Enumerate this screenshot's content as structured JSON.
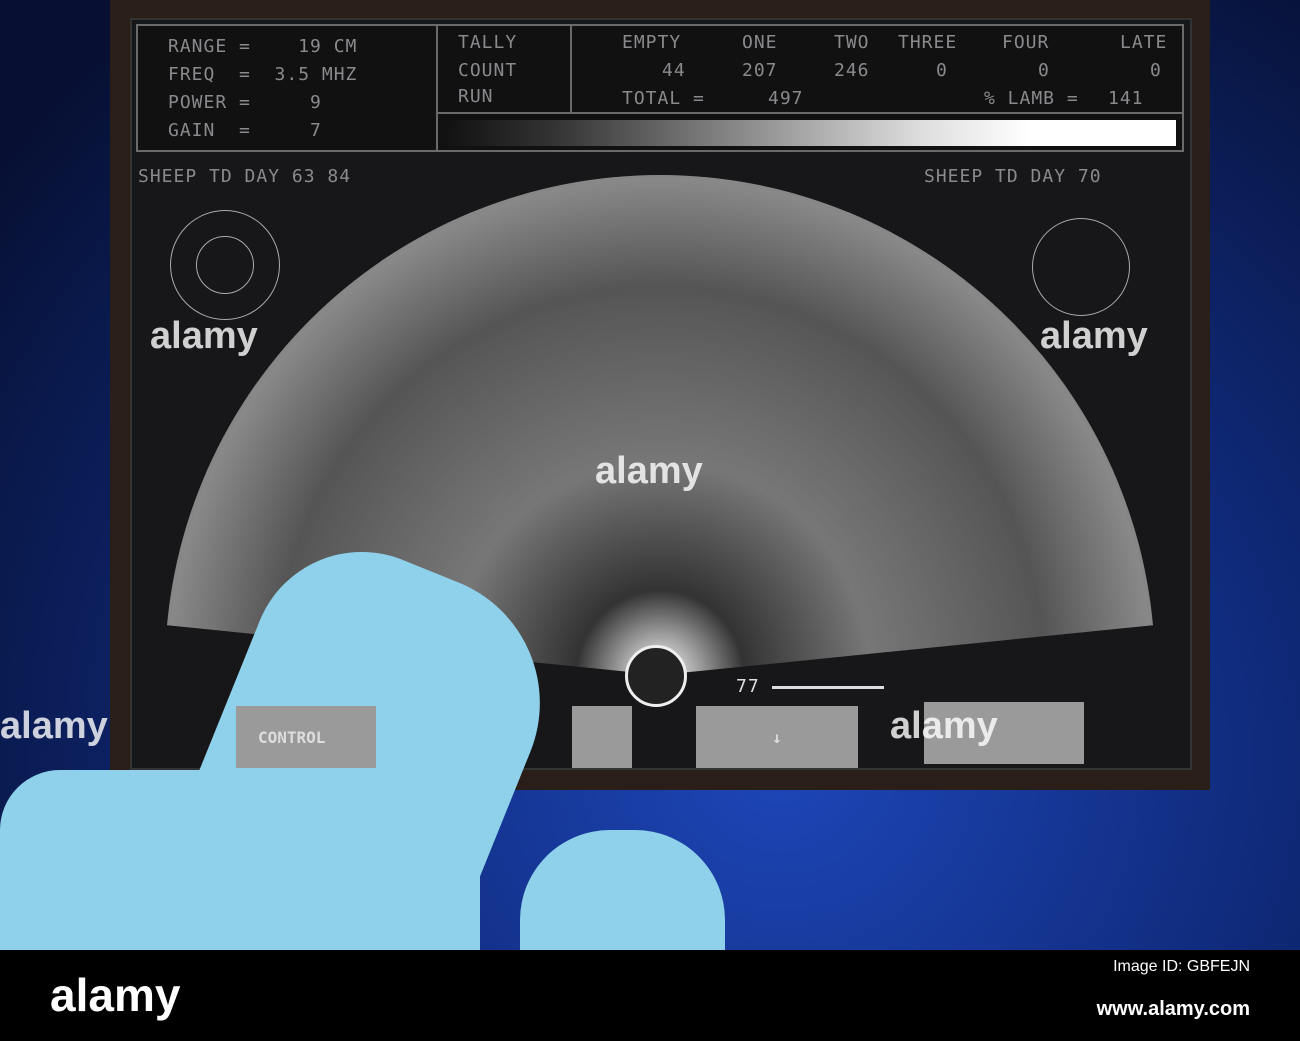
{
  "settings": {
    "range": "RANGE =    19 CM",
    "freq": "FREQ  =  3.5 MHZ",
    "power": "POWER =     9",
    "gain": "GAIN  =     7"
  },
  "tally": {
    "tally": "TALLY",
    "count": "COUNT",
    "run": "RUN"
  },
  "counts": {
    "headers": [
      "EMPTY",
      "ONE",
      "TWO",
      "THREE",
      "FOUR",
      "LATE"
    ],
    "values": [
      "44",
      "207",
      "246",
      "0",
      "0",
      "0"
    ],
    "total_label": "TOTAL =",
    "total": "497",
    "lamb_label": "% LAMB =",
    "lamb": "141"
  },
  "labels": {
    "left": "SHEEP TD DAY 63 84",
    "right": "SHEEP TD DAY 70"
  },
  "scale": {
    "depth": "77"
  },
  "buttons": {
    "control": "CONTROL",
    "down": "↓"
  },
  "watermark": {
    "brand": "alamy",
    "letter": "a",
    "image_id": "Image ID: GBFEJN",
    "url": "www.alamy.com"
  }
}
